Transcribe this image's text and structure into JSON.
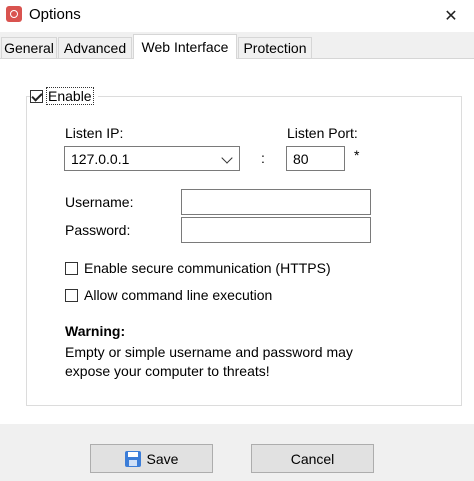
{
  "window": {
    "title": "Options",
    "close_glyph": "✕"
  },
  "tabs": [
    {
      "label": "General",
      "active": false
    },
    {
      "label": "Advanced",
      "active": false
    },
    {
      "label": "Web Interface",
      "active": true
    },
    {
      "label": "Protection",
      "active": false
    }
  ],
  "web_interface": {
    "enable": {
      "label": "Enable",
      "checked": true
    },
    "listen_ip": {
      "label": "Listen IP:",
      "value": "127.0.0.1"
    },
    "separator": ":",
    "listen_port": {
      "label": "Listen Port:",
      "value": "80",
      "required_mark": "*"
    },
    "username": {
      "label": "Username:",
      "value": ""
    },
    "password": {
      "label": "Password:",
      "value": ""
    },
    "https": {
      "label": "Enable secure communication (HTTPS)",
      "checked": false
    },
    "cmdline": {
      "label": "Allow command line execution",
      "checked": false
    },
    "warning": {
      "title": "Warning:",
      "line1": "Empty or simple username and password may",
      "line2": "expose your computer to threats!"
    }
  },
  "footer": {
    "save_label": "Save",
    "cancel_label": "Cancel"
  },
  "icons": {
    "app": "app-logo-icon",
    "close": "close-icon",
    "dropdown": "chevron-down-icon",
    "save": "floppy-disk-icon"
  },
  "colors": {
    "window_bg": "#f0f0f0",
    "panel_bg": "#ffffff",
    "button_bg": "#e1e1e1",
    "app_icon": "#d9534f",
    "save_icon": "#3b7dd8"
  }
}
